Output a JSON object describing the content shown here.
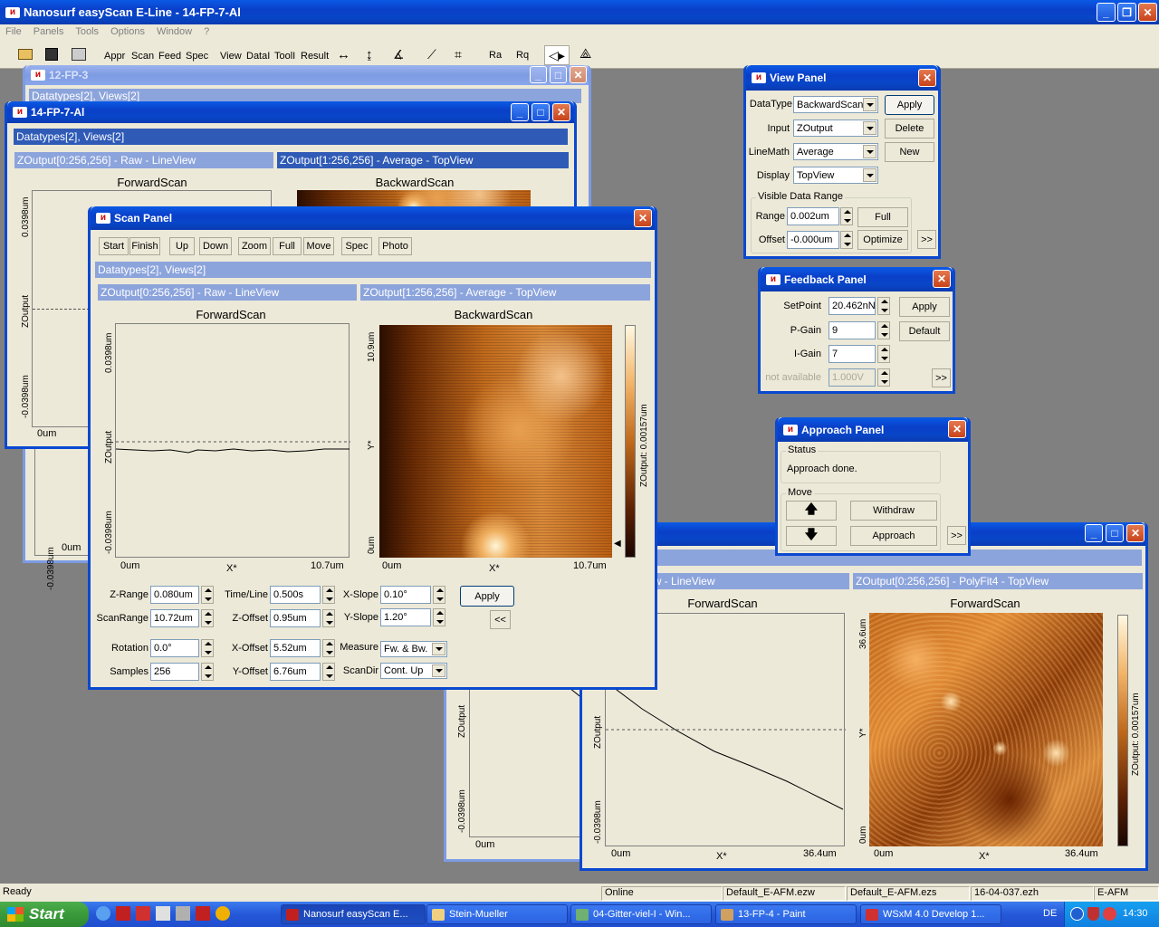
{
  "app": {
    "title": "Nanosurf easyScan E-Line - 14-FP-7-Al"
  },
  "menu": [
    "File",
    "Panels",
    "Tools",
    "Options",
    "Window",
    "?"
  ],
  "toolbar": {
    "appr": "Appr",
    "scan": "Scan",
    "feed": "Feed",
    "spec": "Spec",
    "view": "View",
    "datai": "DataI",
    "tooli": "ToolI",
    "result": "Result",
    "r_a": "Ra",
    "r_q": "Rq"
  },
  "docs": {
    "fp3": {
      "title": "12-FP-3",
      "sub": "Datatypes[2], Views[2]"
    },
    "fp7": {
      "title": "14-FP-7-Al",
      "sub": "Datatypes[2], Views[2]",
      "left_hdr": "ZOutput[0:256,256] - Raw - LineView",
      "right_hdr": "ZOutput[1:256,256] - Average - TopView",
      "left_title": "ForwardScan",
      "right_title": "BackwardScan",
      "y_top": "0.0398um",
      "y_bot": "-0.0398um",
      "y_axis": "ZOutput",
      "x_start": "0um"
    },
    "fp4": {
      "sub": "Views[2]",
      "left_hdr": "256,256] - Raw - LineView",
      "right_hdr": "ZOutput[0:256,256] - PolyFit4 - TopView",
      "left_title": "ForwardScan",
      "right_title": "ForwardScan",
      "x_start": "0um",
      "x_end": "36.4um",
      "x_label": "X*",
      "y_top": "36.6um",
      "y_zero": "0um",
      "y_label": "Y*",
      "cbar_label": "ZOutput: 0.00157um",
      "y_axis": "ZOutput",
      "y_bot": "-0.0398um",
      "back_y_axis": "ZOutput",
      "back_y_bot": "-0.0398um",
      "back_x_start": "0um"
    }
  },
  "scan_panel": {
    "title": "Scan Panel",
    "buttons": {
      "start": "Start",
      "finish": "Finish",
      "up": "Up",
      "down": "Down",
      "zoom": "Zoom",
      "full": "Full",
      "move": "Move",
      "spec": "Spec",
      "photo": "Photo",
      "apply": "Apply",
      "collapse": "<<"
    },
    "sub": "Datatypes[2], Views[2]",
    "left_hdr": "ZOutput[0:256,256] - Raw - LineView",
    "right_hdr": "ZOutput[1:256,256] - Average - TopView",
    "left_title": "ForwardScan",
    "right_title": "BackwardScan",
    "left_y_top": "0.0398um",
    "left_y_bot": "-0.0398um",
    "left_y_axis": "ZOutput",
    "left_x_start": "0um",
    "left_x_end": "10.7um",
    "left_x_label": "X*",
    "right_y_top": "10.9um",
    "right_y_zero": "0um",
    "right_y_label": "Y*",
    "right_x_start": "0um",
    "right_x_end": "10.7um",
    "right_x_label": "X*",
    "cbar_label": "ZOutput: 0.00157um",
    "fields": {
      "zrange_l": "Z-Range",
      "zrange": "0.080um",
      "scanrange_l": "ScanRange",
      "scanrange": "10.72um",
      "rotation_l": "Rotation",
      "rotation": "0.0°",
      "samples_l": "Samples",
      "samples": "256",
      "timeline_l": "Time/Line",
      "timeline": "0.500s",
      "zoffset_l": "Z-Offset",
      "zoffset": "0.95um",
      "xoffset_l": "X-Offset",
      "xoffset": "5.52um",
      "yoffset_l": "Y-Offset",
      "yoffset": "6.76um",
      "xslope_l": "X-Slope",
      "xslope": "0.10°",
      "yslope_l": "Y-Slope",
      "yslope": "1.20°",
      "measure_l": "Measure",
      "measure": "Fw. & Bw.",
      "scandir_l": "ScanDir",
      "scandir": "Cont. Up"
    }
  },
  "view_panel": {
    "title": "View Panel",
    "datatype_l": "DataType",
    "datatype": "BackwardScan",
    "input_l": "Input",
    "input": "ZOutput",
    "linemath_l": "LineMath",
    "linemath": "Average",
    "display_l": "Display",
    "display": "TopView",
    "apply": "Apply",
    "delete": "Delete",
    "new": "New",
    "group": "Visible Data Range",
    "range_l": "Range",
    "range": "0.002um",
    "offset_l": "Offset",
    "offset": "-0.000um",
    "full": "Full",
    "optimize": "Optimize",
    "more": ">>"
  },
  "feedback_panel": {
    "title": "Feedback Panel",
    "setpoint_l": "SetPoint",
    "setpoint": "20.462nN",
    "pgain_l": "P-Gain",
    "pgain": "9",
    "igain_l": "I-Gain",
    "igain": "7",
    "na_l": "not available",
    "na": "1.000V",
    "apply": "Apply",
    "default": "Default",
    "more": ">>"
  },
  "approach_panel": {
    "title": "Approach Panel",
    "status_group": "Status",
    "status": "Approach done.",
    "move_group": "Move",
    "withdraw": "Withdraw",
    "approach": "Approach",
    "more": ">>"
  },
  "statusbar": [
    "Ready",
    "Online",
    "Default_E-AFM.ezw",
    "Default_E-AFM.ezs",
    "16-04-037.ezh",
    "E-AFM"
  ],
  "taskbar": {
    "start": "Start",
    "items": [
      "Nanosurf easyScan E...",
      "Stein-Mueller",
      "04-Gitter-viel-I - Win...",
      "13-FP-4 - Paint",
      "WSxM 4.0 Develop 1..."
    ],
    "lang": "DE",
    "clock": "14:30"
  }
}
